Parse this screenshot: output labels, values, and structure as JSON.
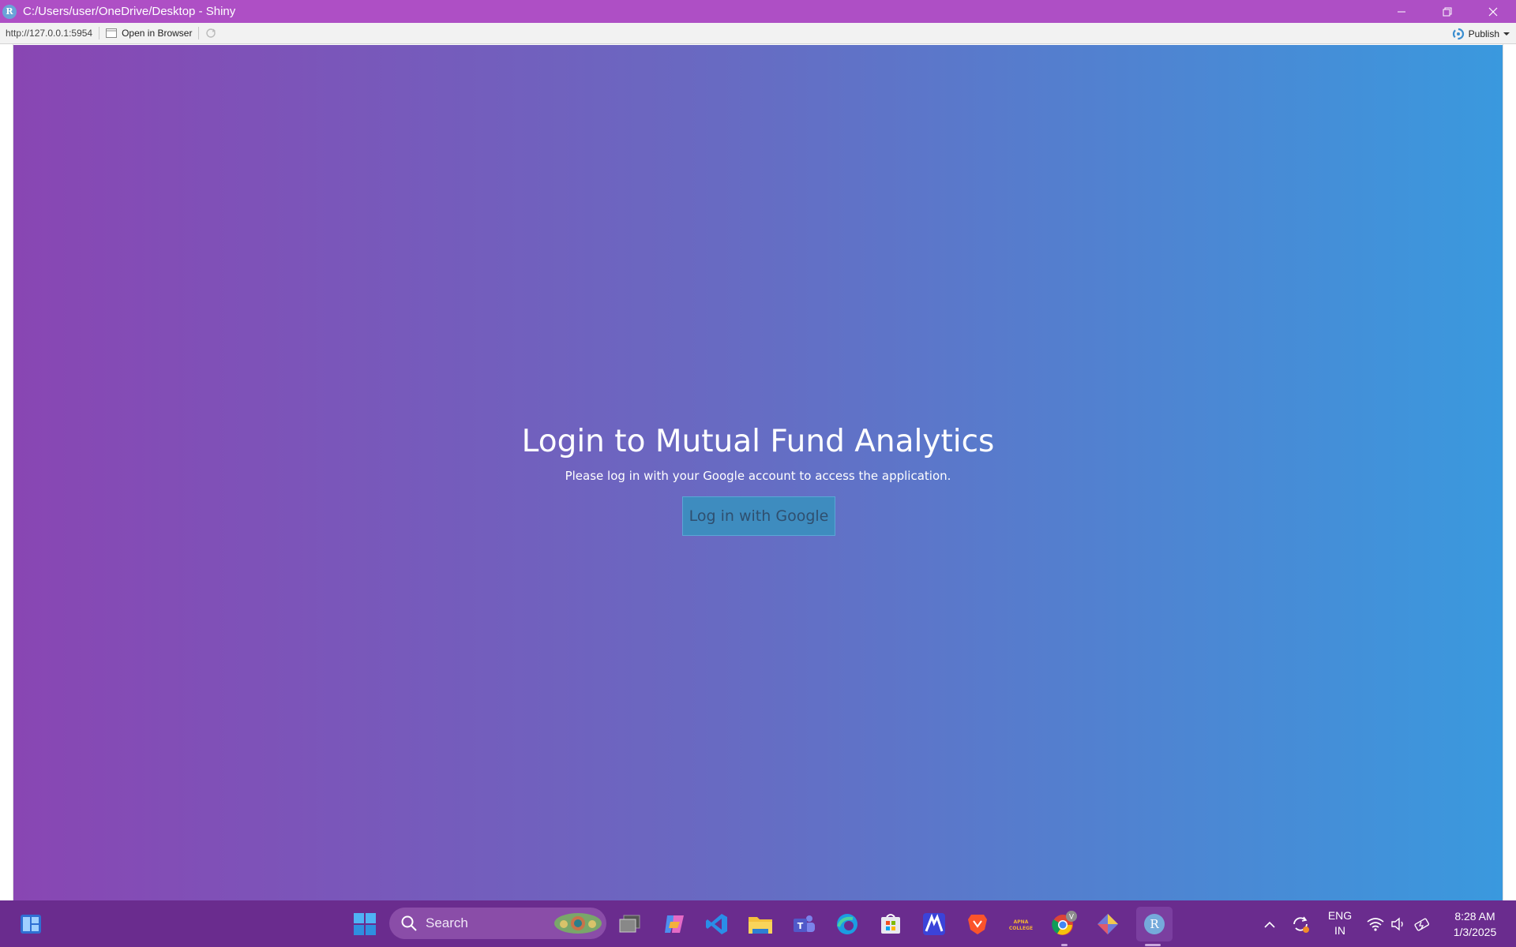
{
  "window": {
    "title": "C:/Users/user/OneDrive/Desktop - Shiny",
    "app_icon_letter": "R"
  },
  "toolbar": {
    "url": "http://127.0.0.1:5954",
    "open_browser_label": "Open in Browser",
    "publish_label": "Publish"
  },
  "login": {
    "title": "Login to Mutual Fund Analytics",
    "subtitle": "Please log in with your Google account to access the application.",
    "button_label": "Log in with Google"
  },
  "taskbar": {
    "search_placeholder": "Search",
    "language_line1": "ENG",
    "language_line2": "IN",
    "time": "8:28 AM",
    "date": "1/3/2025",
    "r_app_letter": "R",
    "chrome_profile_letter": "V",
    "apna_college_label": "APNA COLLEGE"
  },
  "colors": {
    "titlebar": "#ae4fc5",
    "gradient_start": "#8946b3",
    "gradient_end": "#3a99de",
    "taskbar": "#6a2c8e",
    "login_button": "#3e8cbf"
  }
}
